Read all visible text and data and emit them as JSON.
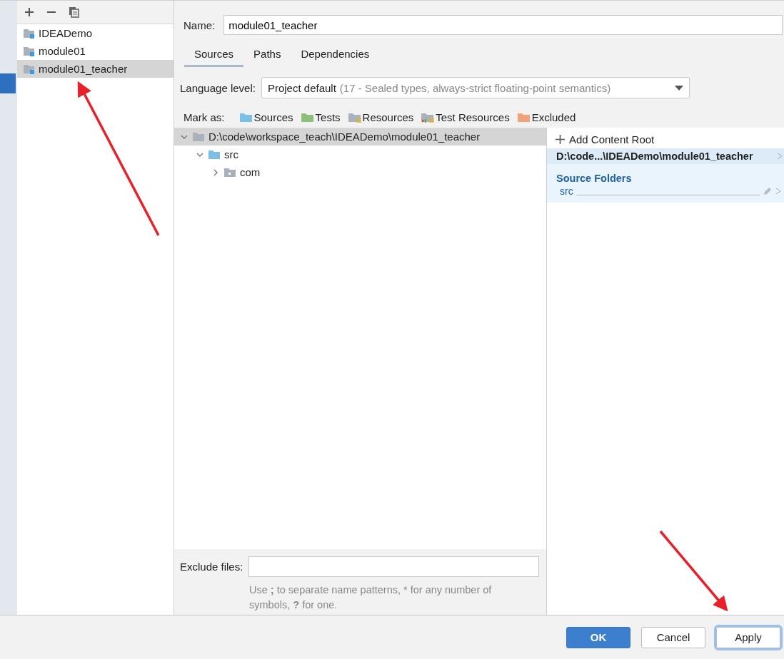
{
  "modules": [
    {
      "name": "IDEADemo",
      "selected": false
    },
    {
      "name": "module01",
      "selected": false
    },
    {
      "name": "module01_teacher",
      "selected": true
    }
  ],
  "name_field": {
    "label": "Name:",
    "value": "module01_teacher"
  },
  "tabs": [
    {
      "label": "Sources",
      "selected": true
    },
    {
      "label": "Paths",
      "selected": false
    },
    {
      "label": "Dependencies",
      "selected": false
    }
  ],
  "language_level": {
    "label": "Language level:",
    "value": "Project default",
    "detail": "(17 - Sealed types, always-strict floating-point semantics)"
  },
  "mark_as": {
    "label": "Mark as:",
    "options": [
      {
        "label": "Sources",
        "kind": "sources"
      },
      {
        "label": "Tests",
        "kind": "tests"
      },
      {
        "label": "Resources",
        "kind": "resources"
      },
      {
        "label": "Test Resources",
        "kind": "test_resources"
      },
      {
        "label": "Excluded",
        "kind": "excluded"
      }
    ]
  },
  "tree": {
    "label": "D:\\code\\workspace_teach\\IDEADemo\\module01_teacher",
    "selected": true,
    "expanded": true,
    "children": [
      {
        "label": "src",
        "kind": "source",
        "expanded": true,
        "children": [
          {
            "label": "com",
            "kind": "package",
            "expanded": false
          }
        ]
      }
    ]
  },
  "content_root": {
    "add_label": "Add Content Root",
    "path": "D:\\code...\\IDEADemo\\module01_teacher",
    "sections": [
      {
        "title": "Source Folders",
        "folders": [
          "src"
        ]
      }
    ]
  },
  "exclude_files": {
    "label": "Exclude files:",
    "help": "Use **;** to separate name patterns, * for any number of symbols, **?** for one."
  },
  "buttons": [
    {
      "label": "OK",
      "kind": "primary"
    },
    {
      "label": "Cancel",
      "kind": "default"
    },
    {
      "label": "Apply",
      "kind": "focused"
    }
  ]
}
